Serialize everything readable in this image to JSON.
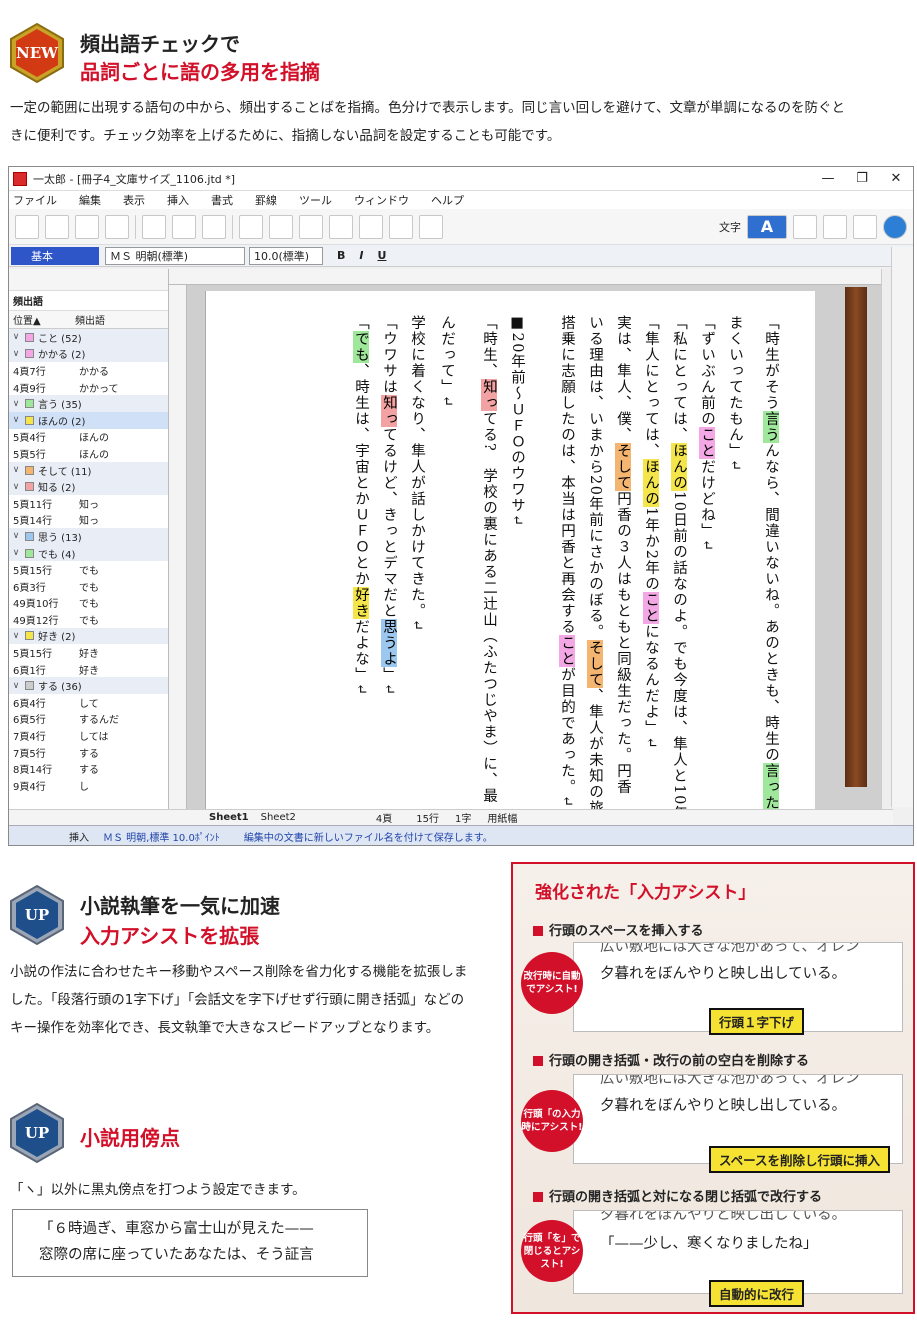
{
  "section1": {
    "badge": "NEW",
    "heading1": "頻出語チェックで",
    "heading2": "品詞ごとに語の多用を指摘",
    "body_line1": "一定の範囲に出現する語句の中から、頻出することばを指摘。色分けで表示します。同じ言い回しを避けて、文章が単調になるのを防ぐと",
    "body_line2": "きに便利です。チェック効率を上げるために、指摘しない品詞を設定することも可能です。"
  },
  "window": {
    "title": "一太郎 - [冊子4_文庫サイズ_1106.jtd *]",
    "controls": [
      "—",
      "❐",
      "✕"
    ],
    "menu": [
      "ファイル",
      "編集",
      "表示",
      "挿入",
      "書式",
      "罫線",
      "ツール",
      "ウィンドウ",
      "ヘルプ"
    ],
    "toolbar_label": "文字",
    "toolbar_mode": "A",
    "style_name": "基本",
    "font_name": "ＭＳ 明朝(標準)",
    "font_size": "10.0(標準)",
    "format_buttons": [
      "B",
      "I",
      "U"
    ],
    "panel": {
      "title": "頻出語",
      "col_pos": "位置▲",
      "col_word": "頻出語",
      "rows": [
        {
          "type": "grp",
          "color": "#f3a7e4",
          "label": "こと (52)"
        },
        {
          "type": "grp",
          "color": "#f3a7e4",
          "label": "かかる (2)"
        },
        {
          "type": "item",
          "pos": "4頁7行",
          "word": "かかる"
        },
        {
          "type": "item",
          "pos": "4頁9行",
          "word": "かかって"
        },
        {
          "type": "grp",
          "color": "#9fe79a",
          "label": "言う (35)"
        },
        {
          "type": "grp",
          "color": "#f4e64a",
          "label": "ほんの (2)",
          "sel": true
        },
        {
          "type": "item",
          "pos": "5頁4行",
          "word": "ほんの"
        },
        {
          "type": "item",
          "pos": "5頁5行",
          "word": "ほんの"
        },
        {
          "type": "grp",
          "color": "#f3b56f",
          "label": "そして (11)"
        },
        {
          "type": "grp",
          "color": "#f2a2a2",
          "label": "知る (2)"
        },
        {
          "type": "item",
          "pos": "5頁11行",
          "word": "知っ"
        },
        {
          "type": "item",
          "pos": "5頁14行",
          "word": "知っ"
        },
        {
          "type": "grp",
          "color": "#9cc8f0",
          "label": "思う (13)"
        },
        {
          "type": "grp",
          "color": "#9fe79a",
          "label": "でも (4)"
        },
        {
          "type": "item",
          "pos": "5頁15行",
          "word": "でも"
        },
        {
          "type": "item",
          "pos": "6頁3行",
          "word": "でも"
        },
        {
          "type": "item",
          "pos": "49頁10行",
          "word": "でも"
        },
        {
          "type": "item",
          "pos": "49頁12行",
          "word": "でも"
        },
        {
          "type": "grp",
          "color": "#f4e64a",
          "label": "好き (2)"
        },
        {
          "type": "item",
          "pos": "5頁15行",
          "word": "好き"
        },
        {
          "type": "item",
          "pos": "6頁1行",
          "word": "好き"
        },
        {
          "type": "grp",
          "color": "#cccccc",
          "label": "する (36)"
        },
        {
          "type": "item",
          "pos": "6頁4行",
          "word": "して"
        },
        {
          "type": "item",
          "pos": "6頁5行",
          "word": "するんだ"
        },
        {
          "type": "item",
          "pos": "7頁4行",
          "word": "しては"
        },
        {
          "type": "item",
          "pos": "7頁5行",
          "word": "する"
        },
        {
          "type": "item",
          "pos": "8頁14行",
          "word": "する"
        },
        {
          "type": "item",
          "pos": "9頁4行",
          "word": "し"
        }
      ]
    },
    "sheets": [
      "Sheet1",
      "Sheet2"
    ],
    "hbar_page": "4頁",
    "hbar_line": "15行",
    "hbar_col": "1字",
    "hbar_paper": "用紙幅",
    "status_mode": "挿入",
    "status_font": "ＭＳ 明朝,標準  10.0ﾎﾟｲﾝﾄ",
    "status_msg": "編集中の文書に新しいファイル名を付けて保存します。"
  },
  "section2": {
    "badge": "UP",
    "heading1": "小説執筆を一気に加速",
    "heading2": "入力アシストを拡張",
    "body": "小説の作法に合わせたキー移動やスペース削除を省力化する機能を拡張しました。「段落行頭の1字下げ」「会話文を字下げせず行頭に開き括弧」などのキー操作を効率化でき、長文執筆で大きなスピードアップとなります。"
  },
  "section3": {
    "badge": "UP",
    "heading": "小説用傍点",
    "body": "「ヽ」以外に黒丸傍点を打つよう設定できます。",
    "quote_line1": "「６時過ぎ、車窓から富士山が見えた——",
    "quote_line2": "窓際の席に座っていたあなたは、そう証言"
  },
  "assist": {
    "title": "強化された「入力アシスト」",
    "items": [
      {
        "sub": "行頭のスペースを挿入する",
        "circle": "改行時に自動でアシスト!",
        "line1": "広い敷地には大きな池があって、オレン",
        "line2": "夕暮れをぼんやりと映し出している。",
        "tag": "行頭１字下げ"
      },
      {
        "sub": "行頭の開き括弧・改行の前の空白を削除する",
        "circle": "行頭「の入力時にアシスト!",
        "line1": "広い敷地には大きな池があって、オレン",
        "line2": "夕暮れをぼんやりと映し出している。",
        "tag": "スペースを削除し行頭に挿入"
      },
      {
        "sub": "行頭の開き括弧と対になる閉じ括弧で改行する",
        "circle": "行頭「を」で閉じるとアシスト!",
        "line1": "夕暮れをぼんやりと映し出している。",
        "line2": "「——少し、寒くなりましたね」",
        "tag": "自動的に改行"
      }
    ]
  }
}
